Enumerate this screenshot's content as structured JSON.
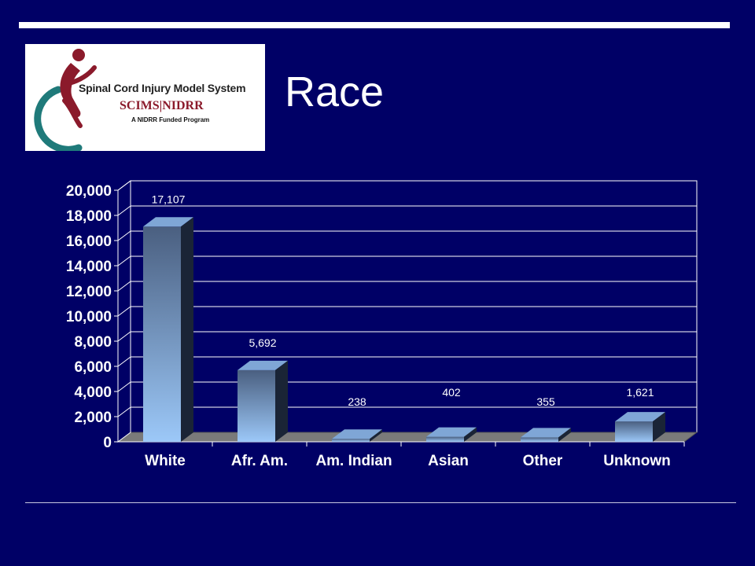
{
  "slide": {
    "title": "Race"
  },
  "logo": {
    "name": "Spinal Cord Injury Model System",
    "subtitle": "SCIMS|NIDRR",
    "tagline": "A NIDRR Funded Program"
  },
  "colors": {
    "background": "#000066",
    "bar_light": "#9cc8f8",
    "bar_dark": "#4a5f80",
    "text": "#ffffff"
  },
  "chart_data": {
    "type": "bar",
    "categories": [
      "White",
      "Afr. Am.",
      "Am. Indian",
      "Asian",
      "Other",
      "Unknown"
    ],
    "values": [
      17107,
      5692,
      238,
      402,
      355,
      1621
    ],
    "data_labels": [
      "17,107",
      "5,692",
      "238",
      "402",
      "355",
      "1,621"
    ],
    "ylim": [
      0,
      20000
    ],
    "y_ticks": [
      0,
      2000,
      4000,
      6000,
      8000,
      10000,
      12000,
      14000,
      16000,
      18000,
      20000
    ],
    "y_tick_labels": [
      "0",
      "2,000",
      "4,000",
      "6,000",
      "8,000",
      "10,000",
      "12,000",
      "14,000",
      "16,000",
      "18,000",
      "20,000"
    ],
    "grid": true,
    "legend": "none",
    "style": "3d"
  }
}
